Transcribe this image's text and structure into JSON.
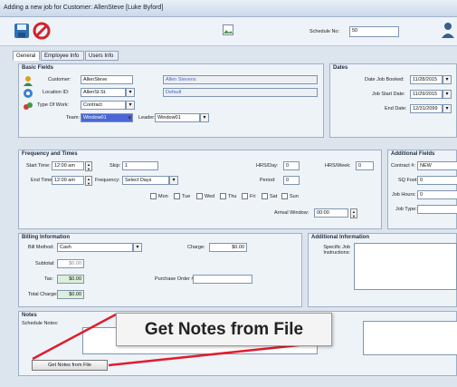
{
  "window": {
    "title": "Adding a new job for Customer: AllenSteve [Luke Byford]"
  },
  "toolbar": {
    "schedule_no_label": "Schedule No:",
    "schedule_no_value": "50"
  },
  "tabs": [
    "General",
    "Employee Info",
    "Users Info"
  ],
  "basic_fields": {
    "title": "Basic Fields",
    "customer_label": "Customer:",
    "customer_value": "AllenSteve",
    "customer_name": "Allen Stevens",
    "location_label": "Location ID:",
    "location_value": "AllenSt.St.",
    "location_default": "Default",
    "type_label": "Type Of Work:",
    "type_value": "Contract",
    "team_label": "Team:",
    "team_value": "Window01",
    "leader_label": "Leader:",
    "leader_value": "Window01"
  },
  "dates": {
    "title": "Dates",
    "booked_label": "Date Job Booked:",
    "booked_value": "11/28/2015",
    "start_label": "Job Start Date:",
    "start_value": "11/29/2015",
    "end_label": "End Date:",
    "end_value": "12/31/2099"
  },
  "frequency": {
    "title": "Frequency and Times",
    "start_label": "Start Time:",
    "start_value": "12:00 am",
    "end_label": "End Time:",
    "end_value": "12:00 am",
    "skip_label": "Skip:",
    "skip_value": "1",
    "freq_label": "Frequency:",
    "freq_value": "Select Days",
    "hrs_day_label": "HRS/Day:",
    "hrs_day_value": "0",
    "hrs_week_label": "HRS/Week:",
    "hrs_week_value": "0",
    "period_label": "Period:",
    "period_value": "0",
    "days": [
      "Mon",
      "Tue",
      "Wed",
      "Thu",
      "Fri",
      "Sat",
      "Sun"
    ],
    "arrival_label": "Arrival Window:",
    "arrival_value": "00:00"
  },
  "additional_fields": {
    "title": "Additional Fields",
    "contract_label": "Contract #:",
    "contract_value": "NEW",
    "sq_label": "SQ Foot:",
    "sq_value": "0",
    "job_hours_label": "Job Hours:",
    "job_hours_value": "0",
    "job_type_label": "Job Type:"
  },
  "billing": {
    "title": "Billing Information",
    "method_label": "Bill Method:",
    "method_value": "Cash",
    "charge_label": "Charge:",
    "charge_value": "$0.00",
    "subtotal_label": "Subtotal:",
    "subtotal_value": "$0.00",
    "tax_label": "Tax:",
    "tax_value": "$0.00",
    "total_label": "Total Charge:",
    "total_value": "$0.00",
    "po_label": "Purchase Order #:"
  },
  "additional_info": {
    "title": "Additional Information",
    "specific_label": "Specific Job Instructions:"
  },
  "notes": {
    "title": "Notes",
    "schedule_label": "Schedule Notes:",
    "button_label": "Get Notes from File",
    "callout_text": "Get Notes from File"
  }
}
